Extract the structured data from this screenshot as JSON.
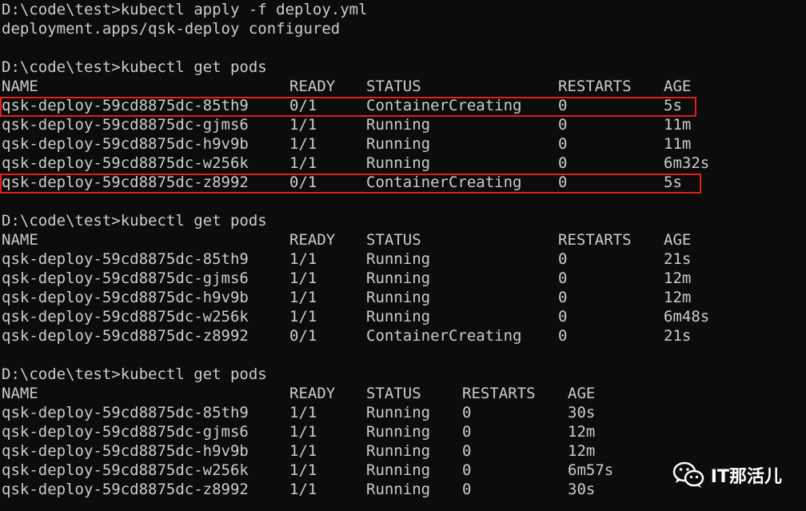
{
  "terminal": {
    "lines": [
      {
        "kind": "text",
        "text": "D:\\code\\test>kubectl apply -f deploy.yml"
      },
      {
        "kind": "text",
        "text": "deployment.apps/qsk-deploy configured"
      },
      {
        "kind": "text",
        "text": ""
      },
      {
        "kind": "text",
        "text": "D:\\code\\test>kubectl get pods"
      }
    ],
    "block1": {
      "header": [
        "NAME",
        "READY",
        "STATUS",
        "RESTARTS",
        "AGE"
      ],
      "rows": [
        [
          "qsk-deploy-59cd8875dc-85th9",
          "0/1",
          "ContainerCreating",
          "0",
          "5s"
        ],
        [
          "qsk-deploy-59cd8875dc-gjms6",
          "1/1",
          "Running",
          "0",
          "11m"
        ],
        [
          "qsk-deploy-59cd8875dc-h9v9b",
          "1/1",
          "Running",
          "0",
          "11m"
        ],
        [
          "qsk-deploy-59cd8875dc-w256k",
          "1/1",
          "Running",
          "0",
          "6m32s"
        ],
        [
          "qsk-deploy-59cd8875dc-z8992",
          "0/1",
          "ContainerCreating",
          "0",
          "5s"
        ]
      ]
    },
    "prompt2": "D:\\code\\test>kubectl get pods",
    "block2": {
      "header": [
        "NAME",
        "READY",
        "STATUS",
        "RESTARTS",
        "AGE"
      ],
      "rows": [
        [
          "qsk-deploy-59cd8875dc-85th9",
          "1/1",
          "Running",
          "0",
          "21s"
        ],
        [
          "qsk-deploy-59cd8875dc-gjms6",
          "1/1",
          "Running",
          "0",
          "12m"
        ],
        [
          "qsk-deploy-59cd8875dc-h9v9b",
          "1/1",
          "Running",
          "0",
          "12m"
        ],
        [
          "qsk-deploy-59cd8875dc-w256k",
          "1/1",
          "Running",
          "0",
          "6m48s"
        ],
        [
          "qsk-deploy-59cd8875dc-z8992",
          "0/1",
          "ContainerCreating",
          "0",
          "21s"
        ]
      ]
    },
    "prompt3": "D:\\code\\test>kubectl get pods",
    "block3": {
      "header": [
        "NAME",
        "READY",
        "STATUS",
        "RESTARTS",
        "AGE"
      ],
      "rows": [
        [
          "qsk-deploy-59cd8875dc-85th9",
          "1/1",
          "Running",
          "0",
          "30s"
        ],
        [
          "qsk-deploy-59cd8875dc-gjms6",
          "1/1",
          "Running",
          "0",
          "12m"
        ],
        [
          "qsk-deploy-59cd8875dc-h9v9b",
          "1/1",
          "Running",
          "0",
          "12m"
        ],
        [
          "qsk-deploy-59cd8875dc-w256k",
          "1/1",
          "Running",
          "0",
          "6m57s"
        ],
        [
          "qsk-deploy-59cd8875dc-z8992",
          "1/1",
          "Running",
          "0",
          "30s"
        ]
      ]
    }
  },
  "watermark": {
    "icon": "wechat-icon",
    "text": "IT那活儿"
  },
  "colors": {
    "background": "#0c0c0c",
    "text": "#cccccc",
    "highlight": "#e0201c"
  }
}
